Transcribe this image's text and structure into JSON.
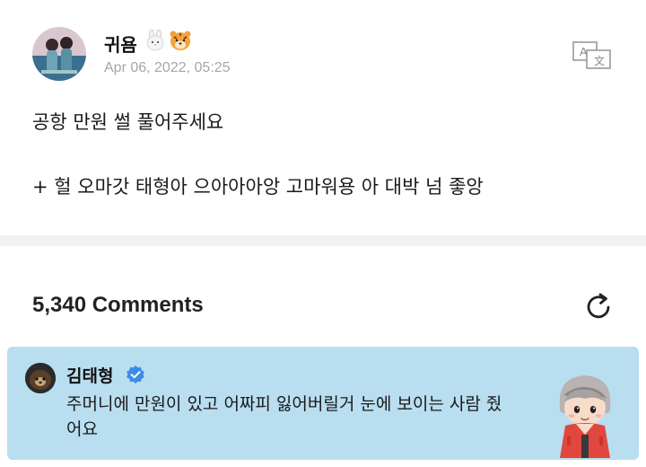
{
  "post": {
    "author": "귀욤",
    "author_emojis": [
      "rabbit-icon",
      "tiger-icon"
    ],
    "timestamp": "Apr 06, 2022, 05:25",
    "line1": "공항 만원 썰 풀어주세요",
    "line2": "+ 헐 오마갓 태형아 으아아아앙 고마워용 아 대박 넘 좋앙"
  },
  "comments": {
    "count_label": "5,340 Comments"
  },
  "featured_comment": {
    "author": "김태형",
    "verified": true,
    "text": "주머니에 만원이 있고 어짜피 잃어버릴거 눈에 보이는 사람 줬어요"
  },
  "colors": {
    "comment_bg": "#b9def0",
    "verified": "#3b8be8",
    "timestamp": "#a6a6a6"
  }
}
